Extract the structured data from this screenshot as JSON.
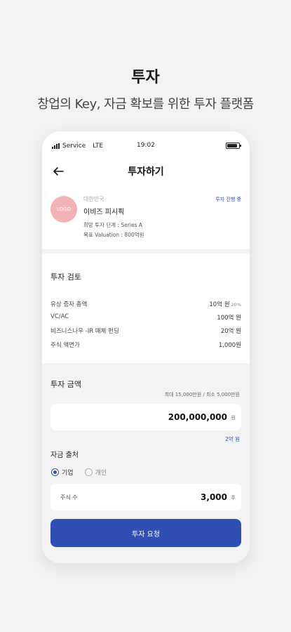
{
  "hero": {
    "title": "투자",
    "subtitle": "창업의 Key, 자금 확보를 위한 투자 플랫폼"
  },
  "status_bar": {
    "carrier": "Service",
    "network": "LTE",
    "time": "19:02",
    "battery_level": 0.9
  },
  "header": {
    "back_icon": "arrow-left-icon",
    "title": "투자하기"
  },
  "company": {
    "logo_text": "LOGO",
    "logo_color": "#f2b2b6",
    "country": "대한민국",
    "name": "이비즈 피시픽",
    "stage": "희망 투자 단계 : Series A",
    "valuation": "목표 Valuation : 800억원",
    "status": "투자 진행 중"
  },
  "review": {
    "title": "투자 검토",
    "rows": [
      {
        "label": "유상 증자 총액",
        "value": "10억 원",
        "note": "20%"
      },
      {
        "label": "VC/AC",
        "value": "100억 원",
        "note": ""
      },
      {
        "label": "비즈니스나우 -IR 매체 펀딩",
        "value": "20억 원",
        "note": ""
      },
      {
        "label": "주식 액면가",
        "value": "1,000원",
        "note": ""
      }
    ]
  },
  "investment": {
    "title": "투자 금액",
    "limit": "최대 15,000만원 / 최소 5,000만원",
    "amount": "200,000,000",
    "amount_unit": "원",
    "amount_hint": "2억 원",
    "source_title": "자금 출처",
    "options": [
      {
        "label": "기업",
        "selected": true
      },
      {
        "label": "개인",
        "selected": false
      }
    ],
    "shares_label": "주식 수",
    "shares_value": "3,000",
    "shares_unit": "주",
    "submit_label": "투자 요청"
  },
  "colors": {
    "accent": "#2f4fb5",
    "background": "#f3f3f3"
  }
}
